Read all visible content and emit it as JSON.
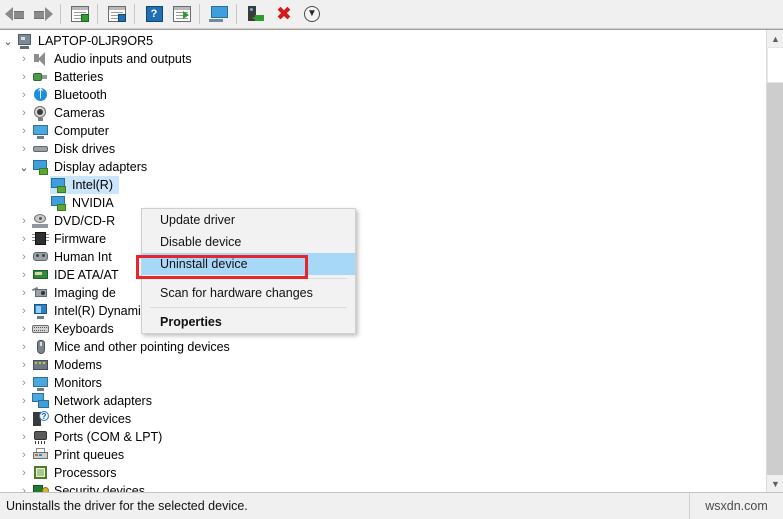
{
  "toolbar": {
    "buttons": [
      {
        "name": "back-button",
        "icon": "back-arrow-icon",
        "label": "Back"
      },
      {
        "name": "forward-button",
        "icon": "forward-arrow-icon",
        "label": "Forward"
      },
      {
        "name": "show-hide-console-tree-button",
        "icon": "console-tree-icon",
        "label": "Show/Hide Console Tree"
      },
      {
        "name": "properties-button",
        "icon": "properties-icon",
        "label": "Properties"
      },
      {
        "name": "help-button",
        "icon": "help-icon",
        "label": "Help"
      },
      {
        "name": "update-driver-button",
        "icon": "update-driver-icon",
        "label": "Update driver"
      },
      {
        "name": "scan-hardware-changes-button",
        "icon": "scan-hardware-icon",
        "label": "Scan for hardware changes"
      },
      {
        "name": "enable-device-button",
        "icon": "enable-device-icon",
        "label": "Enable device"
      },
      {
        "name": "uninstall-device-button",
        "icon": "red-x-icon",
        "label": "Uninstall device"
      },
      {
        "name": "disable-device-button",
        "icon": "disable-device-icon",
        "label": "Disable device"
      }
    ],
    "help_glyph": "?",
    "x_glyph": "✖",
    "down_glyph": "▼"
  },
  "tree": {
    "root": {
      "label": "LAPTOP-0LJR9OR5",
      "icon": "computer-icon",
      "expanded": true
    },
    "items": [
      {
        "label": "Audio inputs and outputs",
        "icon": "speaker-icon",
        "indent": 1,
        "expanded": false
      },
      {
        "label": "Batteries",
        "icon": "battery-icon",
        "indent": 1,
        "expanded": false
      },
      {
        "label": "Bluetooth",
        "icon": "bluetooth-icon",
        "indent": 1,
        "expanded": false
      },
      {
        "label": "Cameras",
        "icon": "camera-icon",
        "indent": 1,
        "expanded": false
      },
      {
        "label": "Computer",
        "icon": "monitor-icon",
        "indent": 1,
        "expanded": false
      },
      {
        "label": "Disk drives",
        "icon": "disk-icon",
        "indent": 1,
        "expanded": false
      },
      {
        "label": "Display adapters",
        "icon": "display-adapter-icon",
        "indent": 1,
        "expanded": true
      },
      {
        "label": "Intel(R)",
        "icon": "display-adapter-icon",
        "indent": 2,
        "selected": true
      },
      {
        "label": "NVIDIA",
        "icon": "display-adapter-icon",
        "indent": 2
      },
      {
        "label": "DVD/CD-R",
        "icon": "dvd-icon",
        "indent": 1,
        "expanded": false
      },
      {
        "label": "Firmware",
        "icon": "firmware-icon",
        "indent": 1,
        "expanded": false
      },
      {
        "label": "Human Int",
        "icon": "hid-icon",
        "indent": 1,
        "expanded": false
      },
      {
        "label": "IDE ATA/AT",
        "icon": "ide-icon",
        "indent": 1,
        "expanded": false
      },
      {
        "label": "Imaging de",
        "icon": "imaging-icon",
        "indent": 1,
        "expanded": false
      },
      {
        "label": "Intel(R) Dynamic Platform and Thermal Framework",
        "icon": "intel-platform-icon",
        "indent": 1,
        "expanded": false
      },
      {
        "label": "Keyboards",
        "icon": "keyboard-icon",
        "indent": 1,
        "expanded": false
      },
      {
        "label": "Mice and other pointing devices",
        "icon": "mouse-icon",
        "indent": 1,
        "expanded": false
      },
      {
        "label": "Modems",
        "icon": "modem-icon",
        "indent": 1,
        "expanded": false
      },
      {
        "label": "Monitors",
        "icon": "monitor-icon",
        "indent": 1,
        "expanded": false
      },
      {
        "label": "Network adapters",
        "icon": "network-adapter-icon",
        "indent": 1,
        "expanded": false
      },
      {
        "label": "Other devices",
        "icon": "other-devices-icon",
        "indent": 1,
        "expanded": false
      },
      {
        "label": "Ports (COM & LPT)",
        "icon": "port-icon",
        "indent": 1,
        "expanded": false
      },
      {
        "label": "Print queues",
        "icon": "printer-icon",
        "indent": 1,
        "expanded": false
      },
      {
        "label": "Processors",
        "icon": "processor-icon",
        "indent": 1,
        "expanded": false
      },
      {
        "label": "Security devices",
        "icon": "security-device-icon",
        "indent": 1,
        "expanded": false
      }
    ],
    "chevron_collapsed": "›",
    "chevron_expanded": "⌄"
  },
  "context_menu": {
    "items": [
      {
        "label": "Update driver",
        "highlighted": false,
        "bold": false
      },
      {
        "label": "Disable device",
        "highlighted": false,
        "bold": false
      },
      {
        "label": "Uninstall device",
        "highlighted": true,
        "bold": false
      },
      {
        "separator": true
      },
      {
        "label": "Scan for hardware changes",
        "highlighted": false,
        "bold": false
      },
      {
        "separator": true
      },
      {
        "label": "Properties",
        "highlighted": false,
        "bold": true
      }
    ],
    "highlight_color": "#a8d8f8",
    "annotation_box_color": "#e8252a"
  },
  "scrollbar": {
    "up_glyph": "▲",
    "down_glyph": "▼"
  },
  "statusbar": {
    "message": "Uninstalls the driver for the selected device.",
    "middle": "",
    "watermark": "wsxdn.com"
  }
}
